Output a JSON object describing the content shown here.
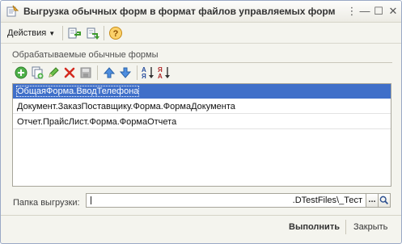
{
  "window": {
    "title": "Выгрузка обычных форм в формат файлов управляемых форм"
  },
  "title_buttons": {
    "menu": "⋮",
    "minimize": "—",
    "maximize": "☐",
    "close": "✕"
  },
  "toolbar": {
    "actions_label": "Действия",
    "icons": [
      "load-settings-icon",
      "save-settings-icon",
      "help-icon"
    ]
  },
  "forms_group": {
    "title": "Обрабатываемые обычные формы",
    "toolbar_icons": [
      "add-icon",
      "copy-icon",
      "edit-icon",
      "delete-icon",
      "save-icon",
      "move-up-icon",
      "move-down-icon",
      "sort-ascending-icon",
      "sort-descending-icon"
    ],
    "rows": [
      "ОбщаяФорма.ВводТелефона",
      "Документ.ЗаказПоставщику.Форма.ФормаДокумента",
      "Отчет.ПрайсЛист.Форма.ФормаОтчета"
    ],
    "selected_row": 0
  },
  "export_folder": {
    "label": "Папка выгрузки:",
    "value": ".DTestFiles\\_Тест",
    "choose_button": "...",
    "open_icon": "search-icon"
  },
  "footer": {
    "run_label": "Выполнить",
    "close_label": "Закрыть"
  },
  "colors": {
    "selection": "#3f6fc9",
    "window_bg": "#f4f4ee"
  }
}
